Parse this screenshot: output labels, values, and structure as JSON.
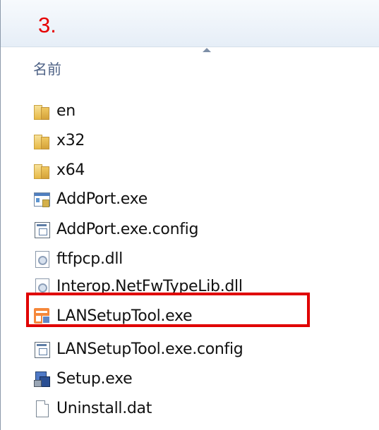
{
  "step_label": "3.",
  "column_header": "名前",
  "files": [
    {
      "name": "en",
      "icon": "folder-icon"
    },
    {
      "name": "x32",
      "icon": "folder-icon"
    },
    {
      "name": "x64",
      "icon": "folder-icon"
    },
    {
      "name": "AddPort.exe",
      "icon": "application-icon"
    },
    {
      "name": "AddPort.exe.config",
      "icon": "config-file-icon"
    },
    {
      "name": "ftfpcp.dll",
      "icon": "dll-file-icon"
    },
    {
      "name": "Interop.NetFwTypeLib.dll",
      "icon": "dll-file-icon"
    },
    {
      "name": "LANSetupTool.exe",
      "icon": "lan-setup-tool-icon"
    },
    {
      "name": "LANSetupTool.exe.config",
      "icon": "config-file-icon"
    },
    {
      "name": "Setup.exe",
      "icon": "setup-icon"
    },
    {
      "name": "Uninstall.dat",
      "icon": "blank-file-icon"
    }
  ],
  "highlighted_file": "LANSetupTool.exe",
  "highlight_color": "#e00000"
}
